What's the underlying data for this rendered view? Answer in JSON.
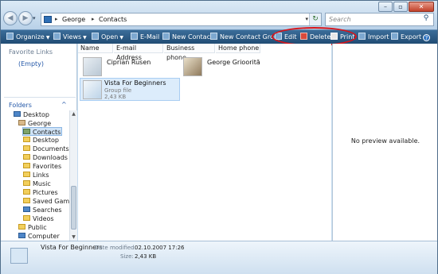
{
  "window": {
    "controls": {
      "minimize": "–",
      "maximize": "▫",
      "close": "✕"
    }
  },
  "nav": {
    "back_glyph": "◀",
    "forward_glyph": "▶",
    "recent_glyph": "▾"
  },
  "address": {
    "crumbs": [
      "George",
      "Contacts"
    ],
    "separator": "▸",
    "drop_glyph": "▾",
    "refresh_glyph": "↻"
  },
  "search": {
    "placeholder": "Search",
    "icon": "magnifier-icon"
  },
  "toolbar": {
    "items": [
      {
        "label": "Organize",
        "icon": "organize-icon",
        "has_menu": true
      },
      {
        "label": "Views",
        "icon": "views-icon",
        "has_menu": true
      },
      {
        "label": "Open",
        "icon": "open-icon",
        "has_menu": true
      },
      {
        "label": "E-Mail",
        "icon": "email-icon",
        "has_menu": false
      },
      {
        "label": "New Contact",
        "icon": "new-contact-icon",
        "has_menu": false
      },
      {
        "label": "New Contact Group",
        "icon": "new-group-icon",
        "has_menu": false
      },
      {
        "label": "Edit",
        "icon": "edit-icon",
        "has_menu": false
      },
      {
        "label": "Delete",
        "icon": "delete-icon",
        "has_menu": false
      },
      {
        "label": "Print",
        "icon": "printer-icon",
        "has_menu": false
      },
      {
        "label": "Import",
        "icon": "import-icon",
        "has_menu": false
      },
      {
        "label": "Export",
        "icon": "export-icon",
        "has_menu": false
      }
    ],
    "help_glyph": "?",
    "highlight_color": "#d8141a"
  },
  "favorites": {
    "title": "Favorite Links",
    "empty_label": "(Empty)"
  },
  "folders": {
    "header": "Folders",
    "caret": "^",
    "tree": [
      {
        "label": "Desktop",
        "kind": "blue",
        "selected": false
      },
      {
        "label": "George",
        "kind": "user",
        "selected": false
      },
      {
        "label": "Contacts",
        "kind": "contact",
        "selected": true
      },
      {
        "label": "Desktop",
        "kind": "folder",
        "selected": false
      },
      {
        "label": "Documents",
        "kind": "folder",
        "selected": false
      },
      {
        "label": "Downloads",
        "kind": "folder",
        "selected": false
      },
      {
        "label": "Favorites",
        "kind": "folder",
        "selected": false
      },
      {
        "label": "Links",
        "kind": "folder",
        "selected": false
      },
      {
        "label": "Music",
        "kind": "folder",
        "selected": false
      },
      {
        "label": "Pictures",
        "kind": "folder",
        "selected": false
      },
      {
        "label": "Saved Games",
        "kind": "folder",
        "selected": false
      },
      {
        "label": "Searches",
        "kind": "blue",
        "selected": false
      },
      {
        "label": "Videos",
        "kind": "folder",
        "selected": false
      },
      {
        "label": "Public",
        "kind": "folder",
        "selected": false
      },
      {
        "label": "Computer",
        "kind": "blue",
        "selected": false
      }
    ]
  },
  "columns": [
    "Name",
    "E-mail Address",
    "Business phone",
    "Home phone"
  ],
  "items": [
    {
      "name": "Ciprian Rusen",
      "subtitle": "",
      "size": "",
      "selected": false
    },
    {
      "name": "George Grioorită",
      "subtitle": "",
      "size": "",
      "selected": false
    },
    {
      "name": "Vista For Beginners",
      "subtitle": "Group file",
      "size": "2,43 KB",
      "selected": true
    }
  ],
  "preview": {
    "message": "No preview available."
  },
  "details": {
    "name": "Vista For Beginners",
    "modified_label": "Date modified:",
    "modified_value": "02.10.2007 17:26",
    "size_label": "Size:",
    "size_value": "2,43 KB"
  }
}
